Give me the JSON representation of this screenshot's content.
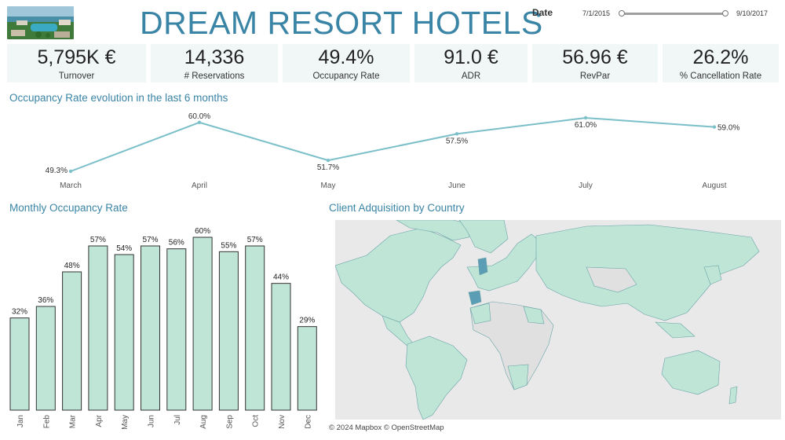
{
  "header": {
    "title": "DREAM RESORT HOTELS",
    "date_filter": {
      "label": "Date",
      "start": "7/1/2015",
      "end": "9/10/2017"
    }
  },
  "kpis": [
    {
      "value": "5,795K €",
      "label": "Turnover"
    },
    {
      "value": "14,336",
      "label": "# Reservations"
    },
    {
      "value": "49.4%",
      "label": "Occupancy Rate"
    },
    {
      "value": "91.0 €",
      "label": "ADR"
    },
    {
      "value": "56.96 €",
      "label": "RevPar"
    },
    {
      "value": "26.2%",
      "label": "% Cancellation Rate"
    }
  ],
  "colors": {
    "title": "#3a84a6",
    "line": "#7bbfc9",
    "bar_fill": "#bfe5d6",
    "bar_stroke": "#333333",
    "map_land": "#bfe5d6",
    "map_highlight": "#5b9db5",
    "map_no_data": "#e0e0e0",
    "kpi_bg": "#f1f7f7"
  },
  "sections": {
    "line_title": "Occupancy Rate evolution in the last 6 months",
    "bar_title": "Monthly Occupancy Rate",
    "map_title": "Client Adquisition by Country"
  },
  "map": {
    "credit": "© 2024 Mapbox © OpenStreetMap"
  },
  "chart_data": [
    {
      "type": "line",
      "title": "Occupancy Rate evolution in the last 6 months",
      "categories": [
        "March",
        "April",
        "May",
        "June",
        "July",
        "August"
      ],
      "values": [
        49.3,
        60.0,
        51.7,
        57.5,
        61.0,
        59.0
      ],
      "labels": [
        "49.3%",
        "60.0%",
        "51.7%",
        "57.5%",
        "61.0%",
        "59.0%"
      ],
      "unit": "%",
      "grid": false
    },
    {
      "type": "bar",
      "title": "Monthly Occupancy Rate",
      "categories": [
        "Jan",
        "Feb",
        "Mar",
        "Apr",
        "May",
        "Jun",
        "Jul",
        "Aug",
        "Sep",
        "Oct",
        "Nov",
        "Dec"
      ],
      "values": [
        32,
        36,
        48,
        57,
        54,
        57,
        56,
        60,
        55,
        57,
        44,
        29
      ],
      "labels": [
        "32%",
        "36%",
        "48%",
        "57%",
        "54%",
        "57%",
        "56%",
        "60%",
        "55%",
        "57%",
        "44%",
        "29%"
      ],
      "unit": "%",
      "ylim": [
        0,
        60
      ],
      "grid": false
    }
  ]
}
